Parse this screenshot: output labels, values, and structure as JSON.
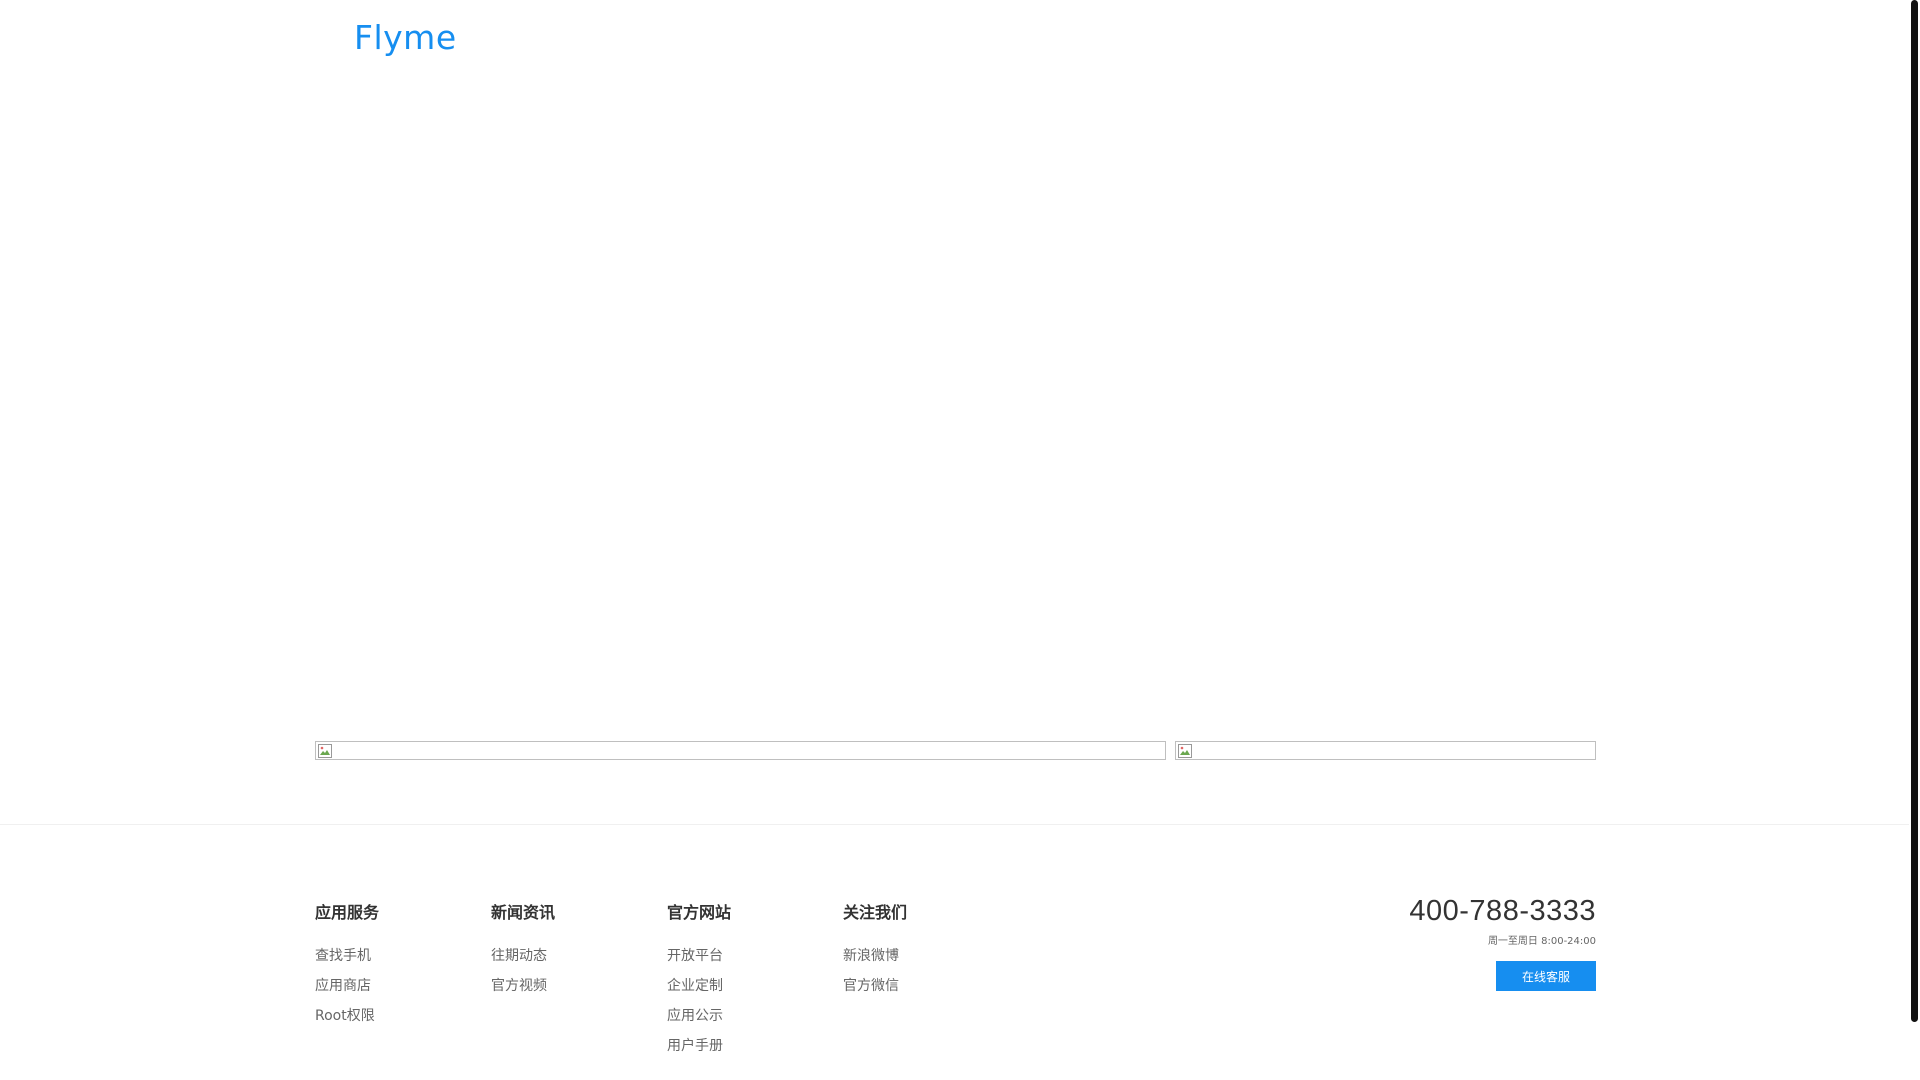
{
  "header": {
    "logo_text": "Flyme"
  },
  "footer": {
    "columns": [
      {
        "title": "应用服务",
        "items": [
          "查找手机",
          "应用商店",
          "Root权限"
        ]
      },
      {
        "title": "新闻资讯",
        "items": [
          "往期动态",
          "官方视频"
        ]
      },
      {
        "title": "官方网站",
        "items": [
          "开放平台",
          "企业定制",
          "应用公示",
          "用户手册"
        ]
      },
      {
        "title": "关注我们",
        "items": [
          "新浪微博",
          "官方微信"
        ]
      }
    ],
    "contact": {
      "phone": "400-788-3333",
      "hours": "周一至周日 8:00-24:00",
      "service_button": "在线客服"
    }
  },
  "colors": {
    "brand": "#168ef0",
    "scrollbar_thumb": "#111111"
  },
  "icons": {
    "banner_placeholder": "broken-image-icon"
  }
}
